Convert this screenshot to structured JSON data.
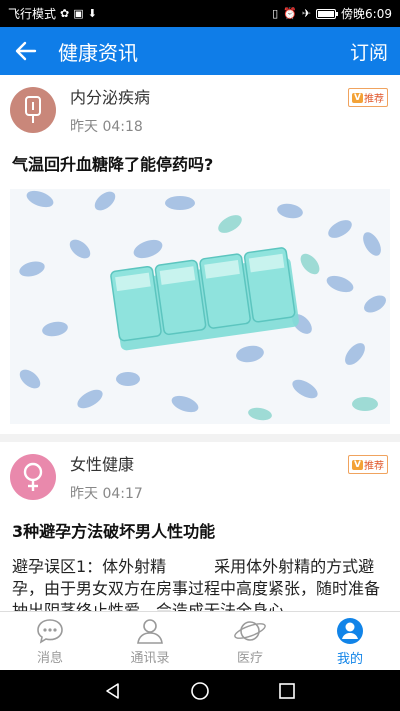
{
  "status_bar": {
    "left_text": "飞行模式",
    "time": "傍晚6:09",
    "icons": [
      "huawei-icon",
      "image-icon",
      "download-icon",
      "vibrate-icon",
      "alarm-icon",
      "airplane-icon",
      "battery-icon"
    ]
  },
  "app_bar": {
    "title": "健康资讯",
    "action": "订阅",
    "color": "#0f7de8"
  },
  "articles": [
    {
      "category": "内分泌疾病",
      "time": "昨天 04:18",
      "badge": "推荐",
      "title": "气温回升血糖降了能停药吗?",
      "avatar_color": "#c9877a",
      "icon": "thermometer-icon"
    },
    {
      "category": "女性健康",
      "time": "昨天 04:17",
      "badge": "推荐",
      "title": "3种避孕方法破坏男人性功能",
      "avatar_color": "#e989ac",
      "icon": "female-icon",
      "body": "避孕误区1：体外射精　　　采用体外射精的方式避孕，由于男女双方在房事过程中高度紧张，随时准备抽出阴茎终止性爱，会造成无法全身心"
    }
  ],
  "tabs": [
    {
      "label": "消息",
      "icon": "chat-icon",
      "active": false
    },
    {
      "label": "通讯录",
      "icon": "contacts-icon",
      "active": false
    },
    {
      "label": "医疗",
      "icon": "planet-icon",
      "active": false
    },
    {
      "label": "我的",
      "icon": "profile-icon",
      "active": true
    }
  ],
  "accent_color": "#1184e8"
}
